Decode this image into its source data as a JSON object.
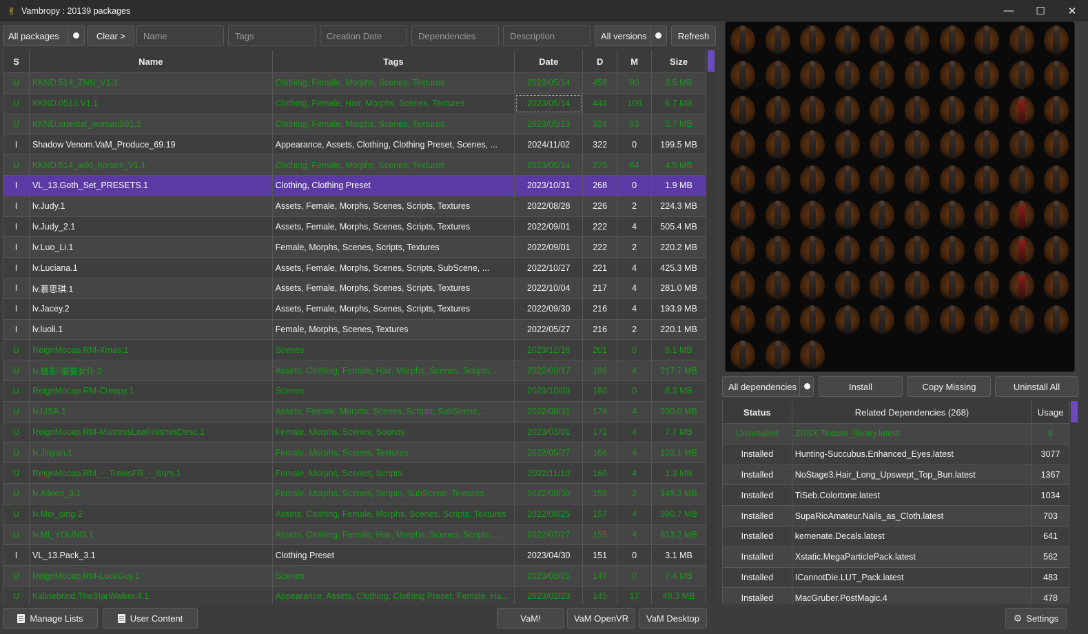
{
  "window": {
    "title": "Vambropy : 20139 packages",
    "minimize": "—",
    "maximize": "☐",
    "close": "✕",
    "app_icon": "✌"
  },
  "toolbar": {
    "filter_label": "All packages",
    "clear_label": "Clear >",
    "name_placeholder": "Name",
    "tags_placeholder": "Tags",
    "date_placeholder": "Creation Date",
    "deps_placeholder": "Dependencies",
    "desc_placeholder": "Description",
    "versions_label": "All versions",
    "refresh_label": "Refresh"
  },
  "packages": {
    "headers": {
      "s": "S",
      "name": "Name",
      "tags": "Tags",
      "date": "Date",
      "d": "D",
      "m": "M",
      "size": "Size"
    },
    "rows": [
      {
        "s": "U",
        "name": "KKND.514_ZNN_V1.1",
        "tags": "Clothing, Female, Morphs, Scenes, Textures",
        "date": "2023/05/14",
        "d": "458",
        "m": "90",
        "size": "3.5 MB"
      },
      {
        "s": "U",
        "name": "KKND.0513.V1.1",
        "tags": "Clothing, Female, Hair, Morphs, Scenes, Textures",
        "date": "2023/05/14",
        "d": "443",
        "m": "109",
        "size": "6.7 MB"
      },
      {
        "s": "U",
        "name": "KKND.oriental_woman501.2",
        "tags": "Clothing, Female, Morphs, Scenes, Textures",
        "date": "2023/05/13",
        "d": "324",
        "m": "53",
        "size": "5.7 MB"
      },
      {
        "s": "I",
        "name": "Shadow Venom.VaM_Produce_69.19",
        "tags": "Appearance, Assets, Clothing, Clothing Preset, Scenes, ...",
        "date": "2024/11/02",
        "d": "322",
        "m": "0",
        "size": "199.5 MB"
      },
      {
        "s": "U",
        "name": "KKND.514_wild_horses_V1.1",
        "tags": "Clothing, Female, Morphs, Scenes, Textures",
        "date": "2023/05/14",
        "d": "275",
        "m": "84",
        "size": "4.5 MB"
      },
      {
        "s": "I",
        "name": "VL_13.Goth_Set_PRESETS.1",
        "tags": "Clothing, Clothing Preset",
        "date": "2023/10/31",
        "d": "268",
        "m": "0",
        "size": "1.9 MB"
      },
      {
        "s": "I",
        "name": "lv.Judy.1",
        "tags": "Assets, Female, Morphs, Scenes, Scripts, Textures",
        "date": "2022/08/28",
        "d": "226",
        "m": "2",
        "size": "224.3 MB"
      },
      {
        "s": "I",
        "name": "lv.Judy_2.1",
        "tags": "Assets, Female, Morphs, Scenes, Scripts, Textures",
        "date": "2022/09/01",
        "d": "222",
        "m": "4",
        "size": "505.4 MB"
      },
      {
        "s": "I",
        "name": "lv.Luo_Li.1",
        "tags": "Female, Morphs, Scenes, Scripts, Textures",
        "date": "2022/09/01",
        "d": "222",
        "m": "2",
        "size": "220.2 MB"
      },
      {
        "s": "I",
        "name": "lv.Luciana.1",
        "tags": "Assets, Female, Morphs, Scenes, Scripts, SubScene, ...",
        "date": "2022/10/27",
        "d": "221",
        "m": "4",
        "size": "425.3 MB"
      },
      {
        "s": "I",
        "name": "lv.慕思琪.1",
        "tags": "Assets, Female, Morphs, Scenes, Scripts, Textures",
        "date": "2022/10/04",
        "d": "217",
        "m": "4",
        "size": "281.0 MB"
      },
      {
        "s": "I",
        "name": "lv.Jacey.2",
        "tags": "Assets, Female, Morphs, Scenes, Scripts, Textures",
        "date": "2022/09/30",
        "d": "216",
        "m": "4",
        "size": "193.9 MB"
      },
      {
        "s": "I",
        "name": "lv.luoli.1",
        "tags": "Female, Morphs, Scenes, Textures",
        "date": "2022/05/27",
        "d": "216",
        "m": "2",
        "size": "220.1 MB"
      },
      {
        "s": "U",
        "name": "ReignMocap.RM-Xmas.1",
        "tags": "Scenes",
        "date": "2023/12/18",
        "d": "201",
        "m": "0",
        "size": "6.1 MB"
      },
      {
        "s": "U",
        "name": "lv.魅影-猫猫女仆.2",
        "tags": "Assets, Clothing, Female, Hair, Morphs, Scenes, Scripts, ...",
        "date": "2022/09/17",
        "d": "196",
        "m": "4",
        "size": "217.7 MB"
      },
      {
        "s": "U",
        "name": "ReignMocap.RM-Creepy.1",
        "tags": "Scenes",
        "date": "2023/10/09",
        "d": "180",
        "m": "0",
        "size": "8.3 MB"
      },
      {
        "s": "U",
        "name": "lv.LISA.1",
        "tags": "Assets, Female, Morphs, Scenes, Scripts, SubScene, ...",
        "date": "2022/08/31",
        "d": "176",
        "m": "4",
        "size": "200.0 MB"
      },
      {
        "s": "U",
        "name": "ReignMocap.RM-MistressLeaFinishesDesc.1",
        "tags": "Female, Morphs, Scenes, Sounds",
        "date": "2023/03/01",
        "d": "172",
        "m": "4",
        "size": "7.7 MB"
      },
      {
        "s": "U",
        "name": "lv.Jinyan.1",
        "tags": "Female, Morphs, Scenes, Textures",
        "date": "2022/05/27",
        "d": "166",
        "m": "4",
        "size": "102.1 MB"
      },
      {
        "s": "U",
        "name": "ReignMocap.RM_-_TravisFR_-_Sqrs.1",
        "tags": "Female, Morphs, Scenes, Scripts",
        "date": "2022/11/10",
        "d": "160",
        "m": "4",
        "size": "1.3 MB"
      },
      {
        "s": "U",
        "name": "lv.Aileen_3.1",
        "tags": "Female, Morphs, Scenes, Scripts, SubScene, Textures",
        "date": "2022/08/30",
        "d": "158",
        "m": "2",
        "size": "148.3 MB"
      },
      {
        "s": "U",
        "name": "lv.Mei_qing.2",
        "tags": "Assets, Clothing, Female, Morphs, Scenes, Scripts, Textures",
        "date": "2022/08/25",
        "d": "157",
        "m": "4",
        "size": "590.7 MB"
      },
      {
        "s": "U",
        "name": "lv.MI_YOUNG.1",
        "tags": "Assets, Clothing, Female, Hair, Morphs, Scenes, Scripts, ...",
        "date": "2022/07/27",
        "d": "155",
        "m": "4",
        "size": "613.2 MB"
      },
      {
        "s": "I",
        "name": "VL_13.Pack_3.1",
        "tags": "Clothing Preset",
        "date": "2023/04/30",
        "d": "151",
        "m": "0",
        "size": "3.1 MB"
      },
      {
        "s": "U",
        "name": "ReignMocap.RM-LuckGuy.1",
        "tags": "Scenes",
        "date": "2023/08/01",
        "d": "147",
        "m": "0",
        "size": "7.4 MB"
      },
      {
        "s": "U",
        "name": "Kalinebrind.TheStarWalker.4.1",
        "tags": "Appearance, Assets, Clothing, Clothing Preset, Female, Ha...",
        "date": "2023/02/23",
        "d": "145",
        "m": "17",
        "size": "48.3 MB"
      }
    ]
  },
  "grid": {
    "rows": 10,
    "cols": 10,
    "count": 93,
    "selected_accent": "#9b1c1c"
  },
  "deps_toolbar": {
    "filter_label": "All dependencies",
    "install_label": "Install",
    "copy_label": "Copy Missing",
    "uninstall_label": "Uninstall All"
  },
  "deps": {
    "headers": {
      "status": "Status",
      "name": "Related Dependencies (268)",
      "usage": "Usage"
    },
    "rows": [
      {
        "status": "Uninstalled",
        "name": "ZRSX.Texture_library.latest",
        "usage": "8"
      },
      {
        "status": "Installed",
        "name": "Hunting-Succubus.Enhanced_Eyes.latest",
        "usage": "3077"
      },
      {
        "status": "Installed",
        "name": "NoStage3.Hair_Long_Upswept_Top_Bun.latest",
        "usage": "1367"
      },
      {
        "status": "Installed",
        "name": "TiSeb.Colortone.latest",
        "usage": "1034"
      },
      {
        "status": "Installed",
        "name": "SupaRioAmateur.Nails_as_Cloth.latest",
        "usage": "703"
      },
      {
        "status": "Installed",
        "name": "kemenate.Decals.latest",
        "usage": "641"
      },
      {
        "status": "Installed",
        "name": "Xstatic.MegaParticlePack.latest",
        "usage": "562"
      },
      {
        "status": "Installed",
        "name": "ICannotDie.LUT_Pack.latest",
        "usage": "483"
      },
      {
        "status": "Installed",
        "name": "MacGruber.PostMagic.4",
        "usage": "478"
      }
    ]
  },
  "footer": {
    "manage_lists": "Manage Lists",
    "user_content": "User Content",
    "vam": "VaM!",
    "vam_openvr": "VaM OpenVR",
    "vam_desktop": "VaM Desktop",
    "settings": "Settings"
  },
  "colors": {
    "selected_row": "#5b3aa3",
    "uninstalled_text": "#1a9a1a",
    "accent_scroll": "#6b4bbd"
  }
}
